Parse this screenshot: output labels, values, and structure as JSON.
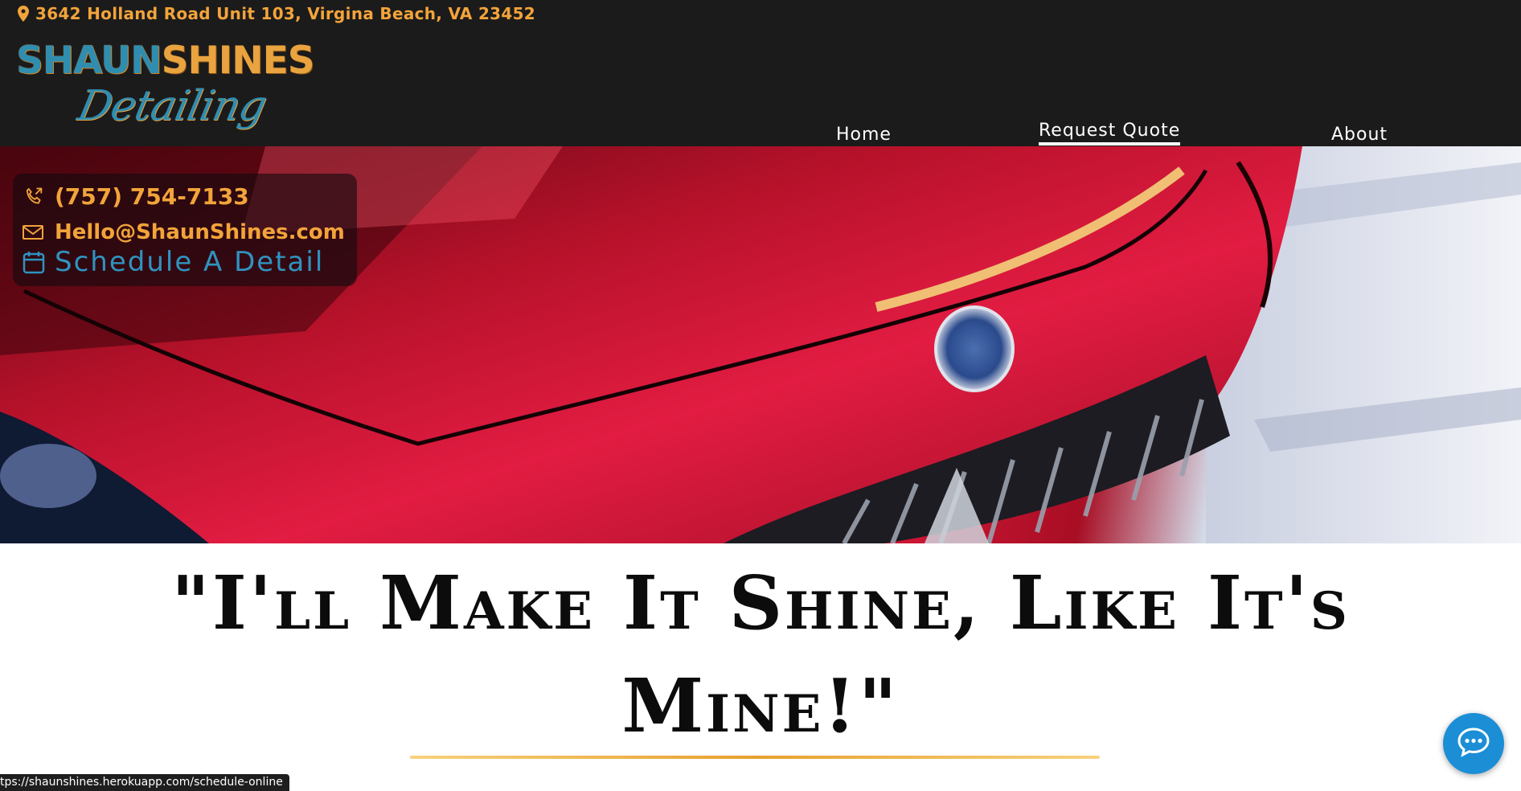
{
  "header": {
    "address": "3642 Holland Road Unit 103, Virgina Beach, VA 23452",
    "logo": {
      "line1_a": "SHAUN",
      "line1_b": "SHINES",
      "line2": "Detailing"
    },
    "nav": [
      {
        "label": "Home"
      },
      {
        "label": "Request Quote",
        "active": true
      },
      {
        "label": "About"
      }
    ]
  },
  "contact": {
    "phone": "(757) 754-7133",
    "email": "Hello@ShaunShines.com",
    "schedule": "Schedule A Detail"
  },
  "hero": {
    "image": "red-maserati-hood-closeup"
  },
  "tagline": {
    "line1": "\"I'll Make It Shine, Like It's",
    "line2": "Mine!\""
  },
  "statusbar": {
    "url": "tps://shaunshines.herokuapp.com/schedule-online"
  },
  "colors": {
    "accent_orange": "#f2a43a",
    "accent_blue": "#2f8db0",
    "header_bg": "#1c1b1b",
    "chat_blue": "#1b8ed6"
  },
  "icons": [
    "map-pin-icon",
    "phone-icon",
    "mail-icon",
    "calendar-icon",
    "chat-icon"
  ]
}
